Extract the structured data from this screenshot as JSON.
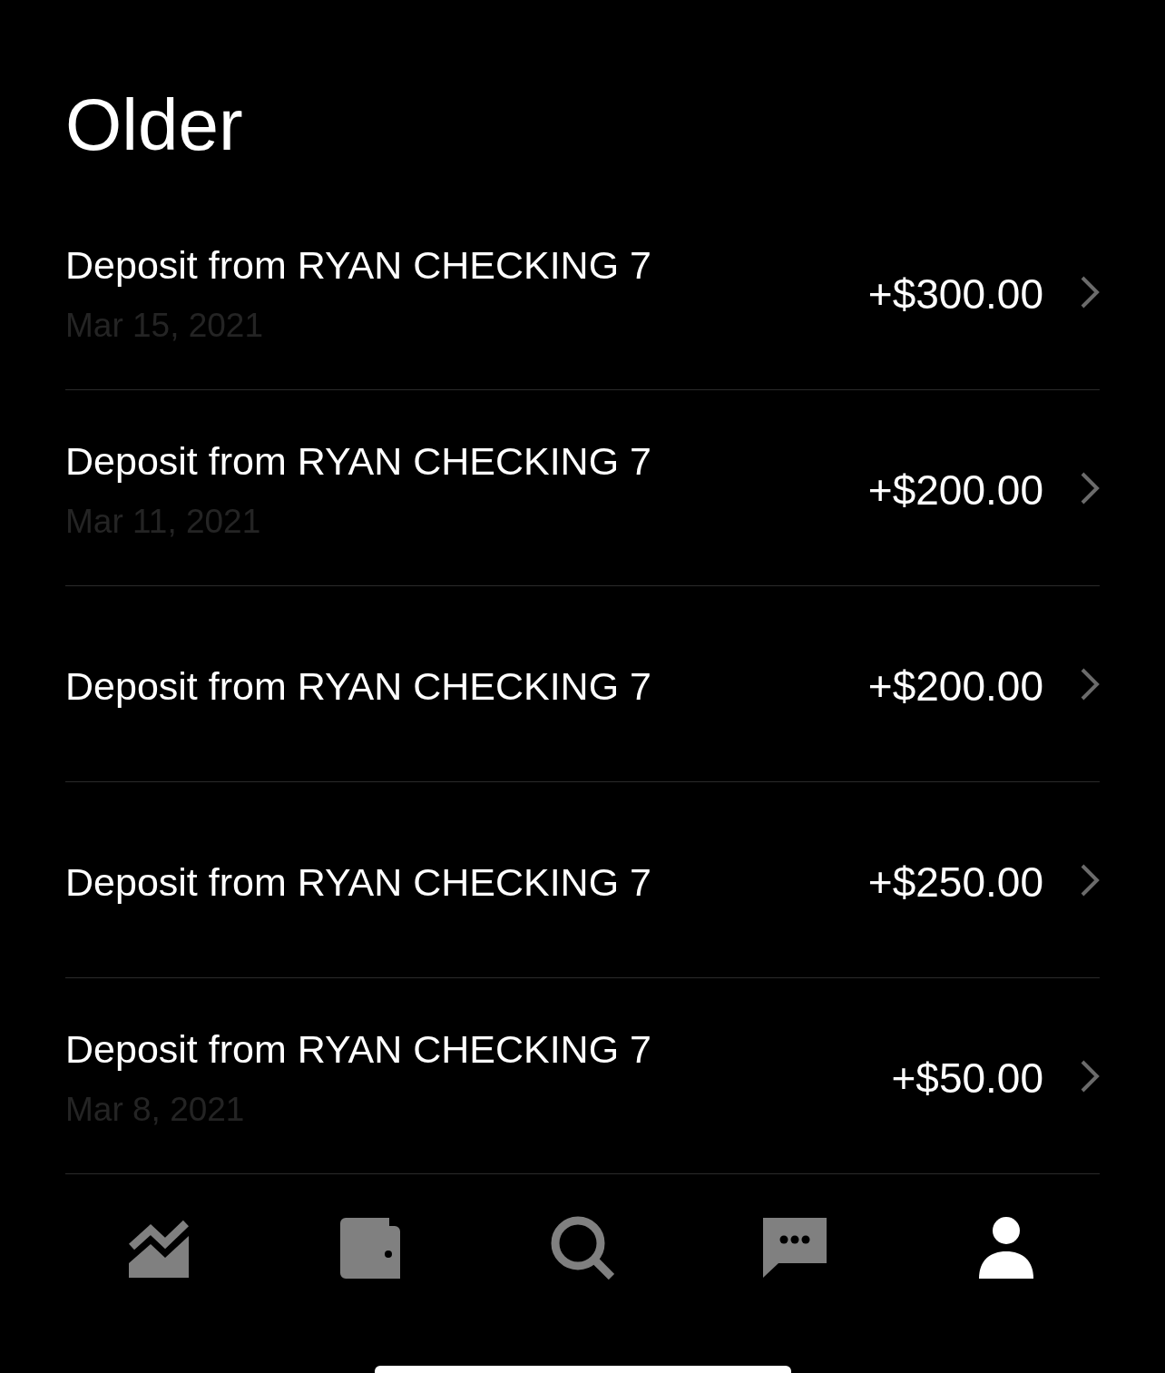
{
  "section": {
    "title": "Older"
  },
  "transactions": [
    {
      "title": "Deposit from RYAN CHECKING 7",
      "date": "Mar 15, 2021",
      "amount": "+$300.00"
    },
    {
      "title": "Deposit from RYAN CHECKING 7",
      "date": "Mar 11, 2021",
      "amount": "+$200.00"
    },
    {
      "title": "Deposit from RYAN CHECKING 7",
      "amount": "+$200.00"
    },
    {
      "title": "Deposit from RYAN CHECKING 7",
      "amount": "+$250.00"
    },
    {
      "title": "Deposit from RYAN CHECKING 7",
      "date": "Mar 8, 2021",
      "amount": "+$50.00"
    }
  ],
  "tab_bar": {
    "items": [
      {
        "kind": "chart",
        "selected": false
      },
      {
        "kind": "wallet",
        "selected": false
      },
      {
        "kind": "search",
        "selected": false
      },
      {
        "kind": "chat",
        "selected": false
      },
      {
        "kind": "profile",
        "selected": true
      }
    ]
  }
}
